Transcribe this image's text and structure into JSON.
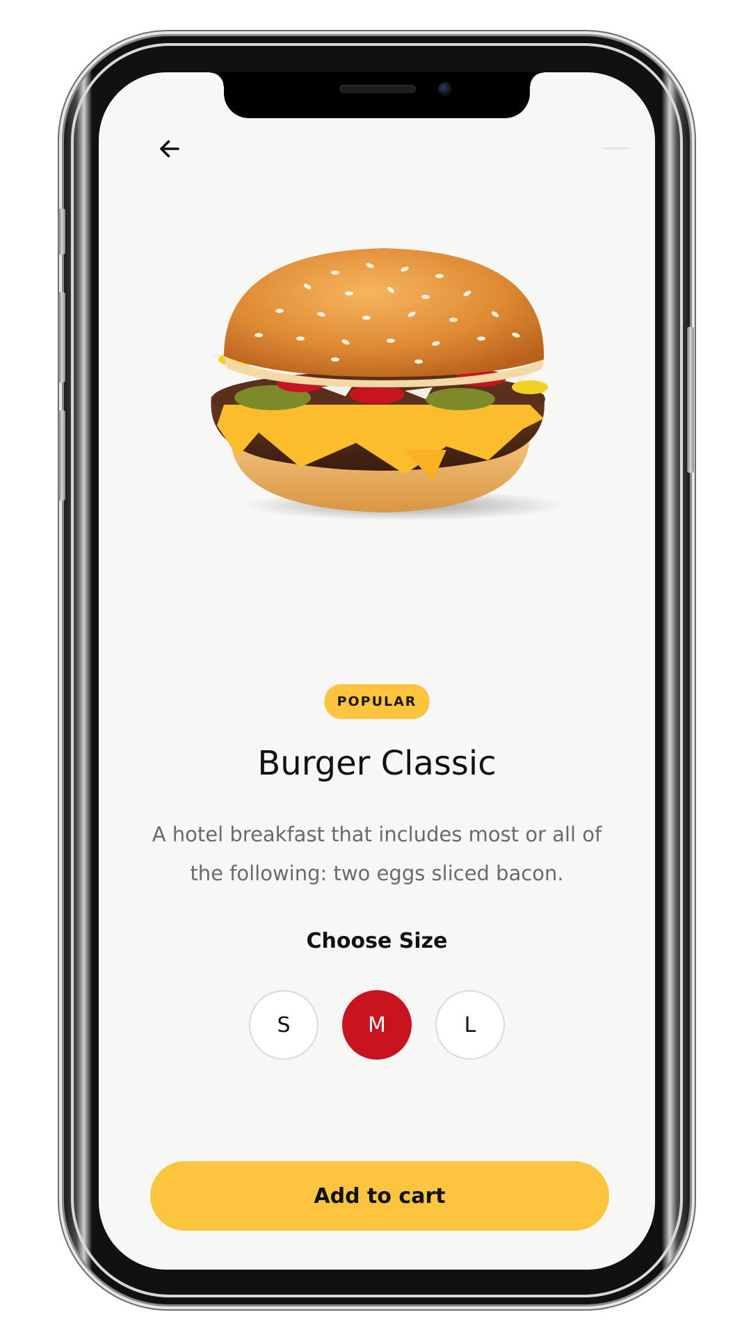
{
  "nav": {
    "back_icon": "arrow-left-icon"
  },
  "product": {
    "image_icon": "burger-image",
    "badge": "POPULAR",
    "name": "Burger Classic",
    "description": "A hotel breakfast that includes most or all of the following: two eggs sliced bacon."
  },
  "size_picker": {
    "label": "Choose Size",
    "options": [
      "S",
      "M",
      "L"
    ],
    "selected": "M"
  },
  "cart": {
    "button_label": "Add to cart"
  },
  "colors": {
    "accent_yellow": "#fcc43f",
    "selected_red": "#c8141e",
    "background": "#f7f7f5"
  }
}
